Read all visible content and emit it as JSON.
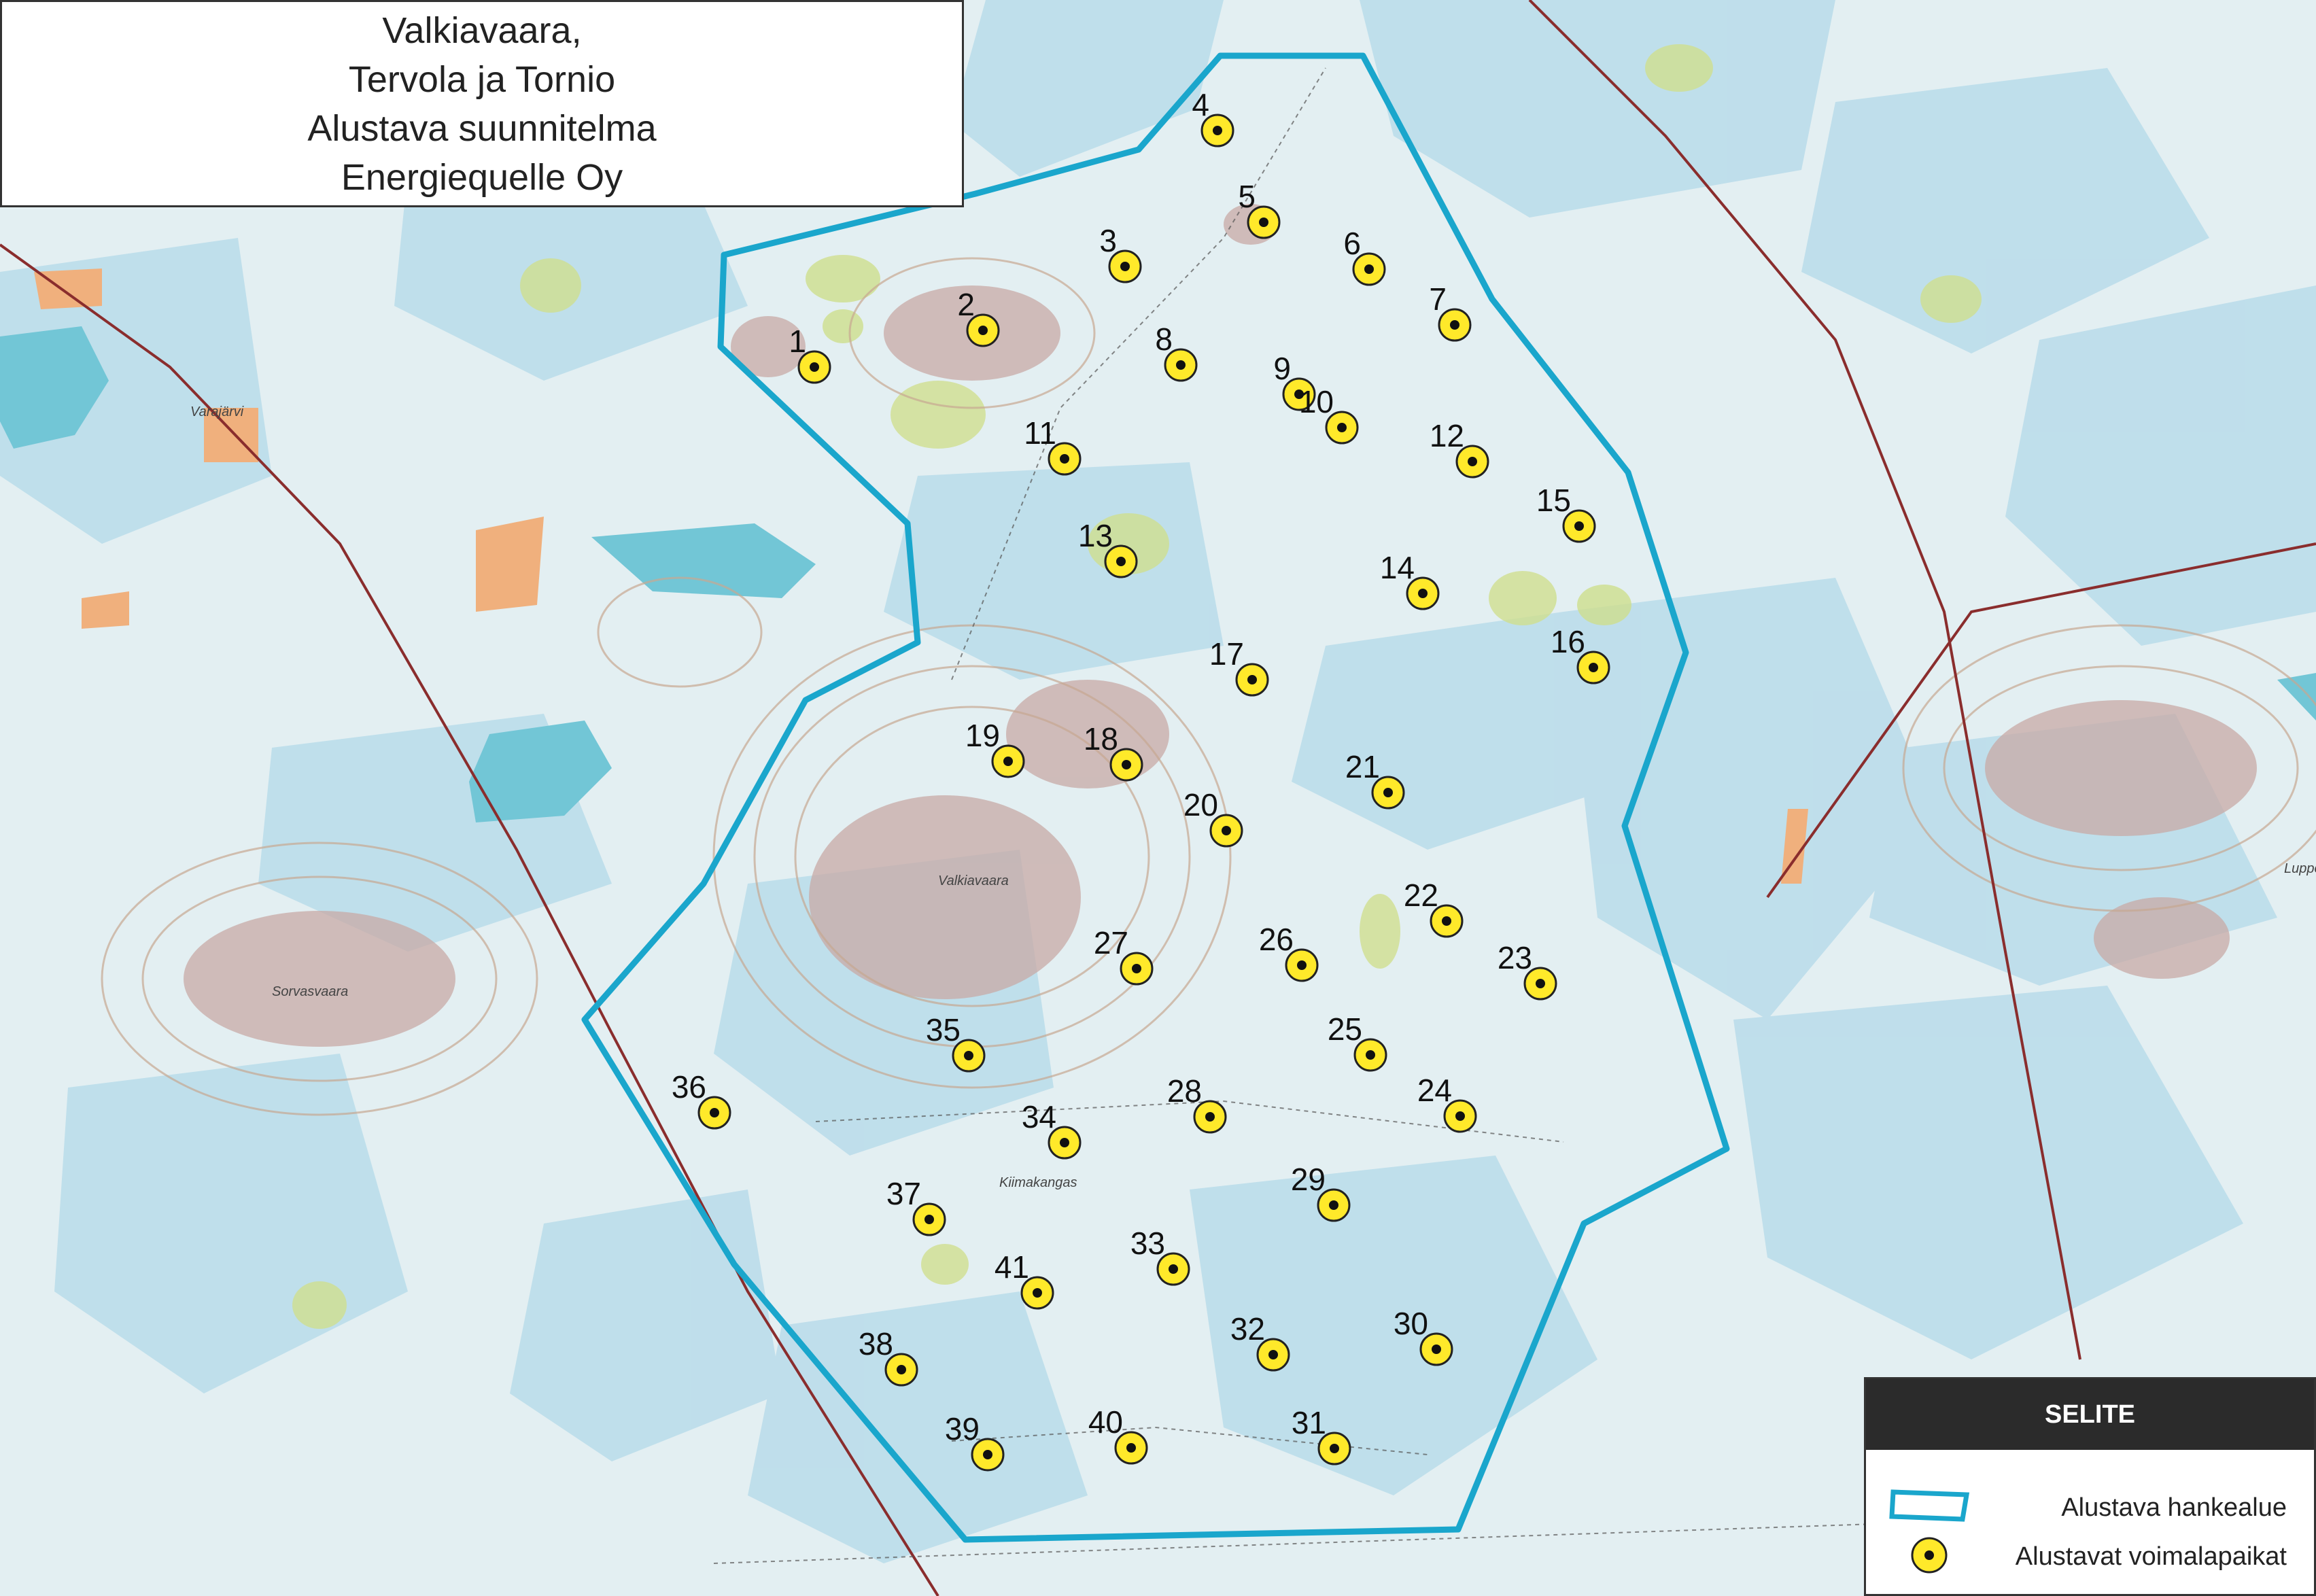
{
  "title": {
    "lines": [
      "Valkiavaara,",
      "Tervola ja Tornio",
      "Alustava suunnitelma",
      "Energiequelle Oy"
    ]
  },
  "legend": {
    "header": "SELITE",
    "items": [
      {
        "label": "Alustava hankealue",
        "symbol": "area-outline-icon"
      },
      {
        "label": "Alustavat voimalapaikat",
        "symbol": "turbine-marker-icon"
      }
    ]
  },
  "colors": {
    "boundary": "#1aa6cc",
    "turbine_fill": "#ffe92a",
    "turbine_dot": "#111111",
    "water": "#6fc7d8",
    "wetland": "#b9dde8",
    "hill": "#c9aaa8",
    "field": "#f0b07d",
    "meadow": "#cfdf8e",
    "road": "#8a2d2d"
  },
  "place_names": [
    "Varajärvi",
    "Valkiavaara",
    "Sorvasvaara",
    "Kiimakangas",
    "Luppova"
  ],
  "turbines": [
    "1",
    "2",
    "3",
    "4",
    "5",
    "6",
    "7",
    "8",
    "9",
    "10",
    "11",
    "12",
    "13",
    "14",
    "15",
    "16",
    "17",
    "18",
    "19",
    "20",
    "21",
    "22",
    "23",
    "24",
    "25",
    "26",
    "27",
    "28",
    "29",
    "30",
    "31",
    "32",
    "33",
    "34",
    "35",
    "36",
    "37",
    "38",
    "39",
    "40",
    "41"
  ]
}
